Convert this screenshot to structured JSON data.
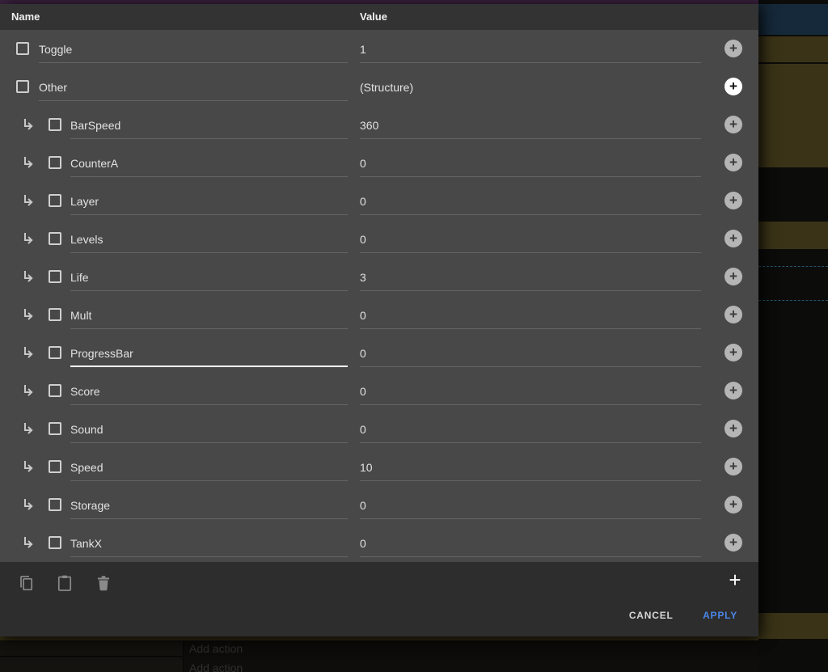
{
  "colors": {
    "top-bar-purple": "#3b2240",
    "header-bg": "#333333",
    "rows-bg": "#484848",
    "footer-bg": "#2d2d2d",
    "text": "#e2e2e2",
    "apply-blue": "#4a86e8",
    "bg-olive": "#3a3317",
    "bg-teal": "#16293a",
    "bg-black": "#0c0c0b"
  },
  "dialog": {
    "columns": {
      "name": "Name",
      "value": "Value"
    },
    "rows": [
      {
        "name": "Toggle",
        "value": "1",
        "child": false,
        "structure": false,
        "plus_highlight": false,
        "focused": false
      },
      {
        "name": "Other",
        "value": "(Structure)",
        "child": false,
        "structure": true,
        "plus_highlight": true,
        "focused": false
      },
      {
        "name": "BarSpeed",
        "value": "360",
        "child": true,
        "structure": false,
        "plus_highlight": false,
        "focused": false
      },
      {
        "name": "CounterA",
        "value": "0",
        "child": true,
        "structure": false,
        "plus_highlight": false,
        "focused": false
      },
      {
        "name": "Layer",
        "value": "0",
        "child": true,
        "structure": false,
        "plus_highlight": false,
        "focused": false
      },
      {
        "name": "Levels",
        "value": "0",
        "child": true,
        "structure": false,
        "plus_highlight": false,
        "focused": false
      },
      {
        "name": "Life",
        "value": "3",
        "child": true,
        "structure": false,
        "plus_highlight": false,
        "focused": false
      },
      {
        "name": "Mult",
        "value": "0",
        "child": true,
        "structure": false,
        "plus_highlight": false,
        "focused": false
      },
      {
        "name": "ProgressBar",
        "value": "0",
        "child": true,
        "structure": false,
        "plus_highlight": false,
        "focused": true
      },
      {
        "name": "Score",
        "value": "0",
        "child": true,
        "structure": false,
        "plus_highlight": false,
        "focused": false
      },
      {
        "name": "Sound",
        "value": "0",
        "child": true,
        "structure": false,
        "plus_highlight": false,
        "focused": false
      },
      {
        "name": "Speed",
        "value": "10",
        "child": true,
        "structure": false,
        "plus_highlight": false,
        "focused": false
      },
      {
        "name": "Storage",
        "value": "0",
        "child": true,
        "structure": false,
        "plus_highlight": false,
        "focused": false
      },
      {
        "name": "TankX",
        "value": "0",
        "child": true,
        "structure": false,
        "plus_highlight": false,
        "focused": false
      }
    ],
    "row_plus_label": "+",
    "footer": {
      "add_label": "+",
      "cancel_label": "CANCEL",
      "apply_label": "APPLY"
    }
  },
  "background": {
    "add_action_rows": [
      "Add action",
      "Add action"
    ]
  }
}
